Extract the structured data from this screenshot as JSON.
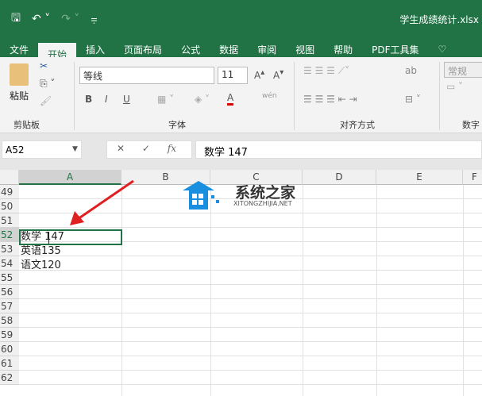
{
  "window": {
    "title": "学生成绩统计.xlsx"
  },
  "tabs": [
    "文件",
    "开始",
    "插入",
    "页面布局",
    "公式",
    "数据",
    "审阅",
    "视图",
    "帮助",
    "PDF工具集"
  ],
  "ribbon": {
    "paste": "粘贴",
    "clipboard": "剪贴板",
    "font_name": "等线",
    "font_size": "11",
    "font_group": "字体",
    "align_group": "对齐方式",
    "number_format": "常规",
    "number_group": "数字",
    "bold": "B",
    "italic": "I",
    "underline": "U",
    "font_color": "A",
    "wen": "wén"
  },
  "formula_bar": {
    "name_box": "A52",
    "content": "数学 147",
    "fx": "fx"
  },
  "columns": [
    "A",
    "B",
    "C",
    "D",
    "E",
    "F"
  ],
  "rows": [
    "49",
    "50",
    "51",
    "52",
    "53",
    "54",
    "55",
    "56",
    "57",
    "58",
    "59",
    "60",
    "61",
    "62"
  ],
  "cells": {
    "A52": "数学 147",
    "A53": "英语135",
    "A54": "语文120"
  },
  "watermark": {
    "title": "系统之家",
    "url": "XITONGZHIJIA.NET"
  },
  "colors": {
    "accent": "#217346",
    "arrow": "#e02020"
  }
}
